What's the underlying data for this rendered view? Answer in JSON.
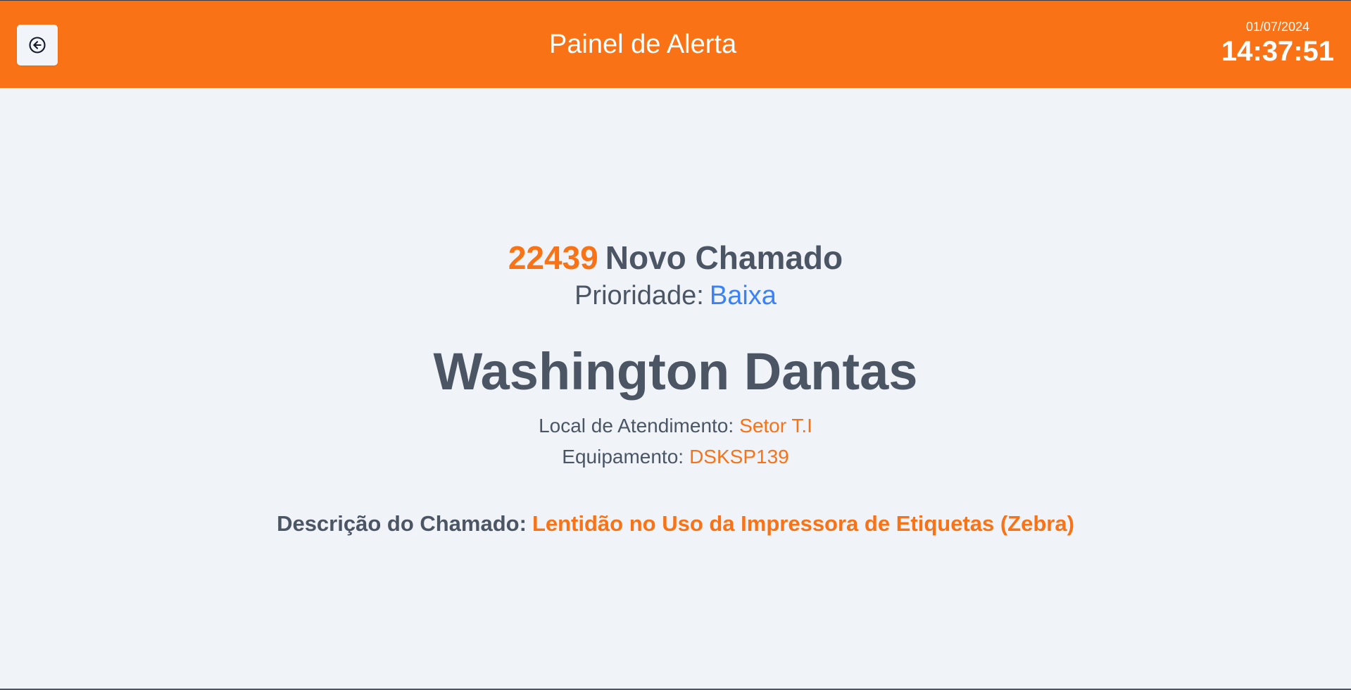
{
  "header": {
    "title": "Painel de Alerta",
    "back_icon": "arrow-left-circle-icon",
    "date": "01/07/2024",
    "time": "14:37:51",
    "background_color": "#f97316"
  },
  "ticket": {
    "number": "22439",
    "status": "Novo Chamado",
    "priority_label": "Prioridade:",
    "priority_value": "Baixa",
    "requester": "Washington Dantas",
    "location_label": "Local de Atendimento:",
    "location_value": "Setor T.I",
    "equipment_label": "Equipamento:",
    "equipment_value": "DSKSP139",
    "description_label": "Descrição do Chamado:",
    "description_value": "Lentidão no Uso da Impressora de Etiquetas (Zebra)"
  },
  "colors": {
    "accent": "#f97316",
    "priority_low": "#3b82f6",
    "text": "#4b5563",
    "background": "#f0f4f8"
  }
}
